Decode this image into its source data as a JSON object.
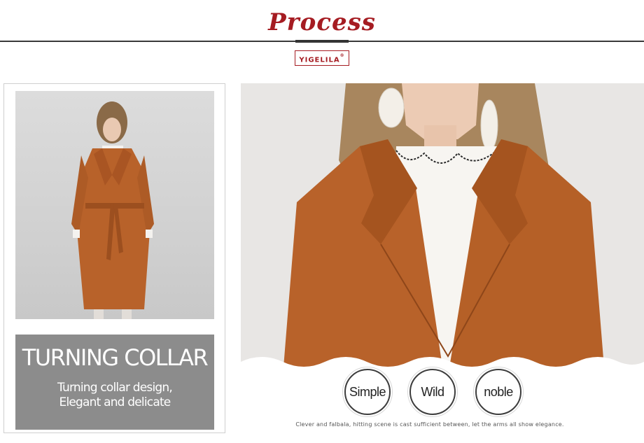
{
  "header": {
    "title": "Process",
    "logo": "YIGELILA",
    "logo_mark": "®"
  },
  "feature": {
    "heading": "TURNING COLLAR",
    "subtitle_line1": "Turning collar design,",
    "subtitle_line2": "Elegant and delicate"
  },
  "tags": [
    "Simple",
    "Wild",
    "noble"
  ],
  "caption": "Clever and falbala, hitting scene is cast sufficient between, let the arms all show elegance.",
  "colors": {
    "accent": "#a51c22",
    "coat": "#b8622a",
    "panel_gray": "#8c8c8c"
  }
}
